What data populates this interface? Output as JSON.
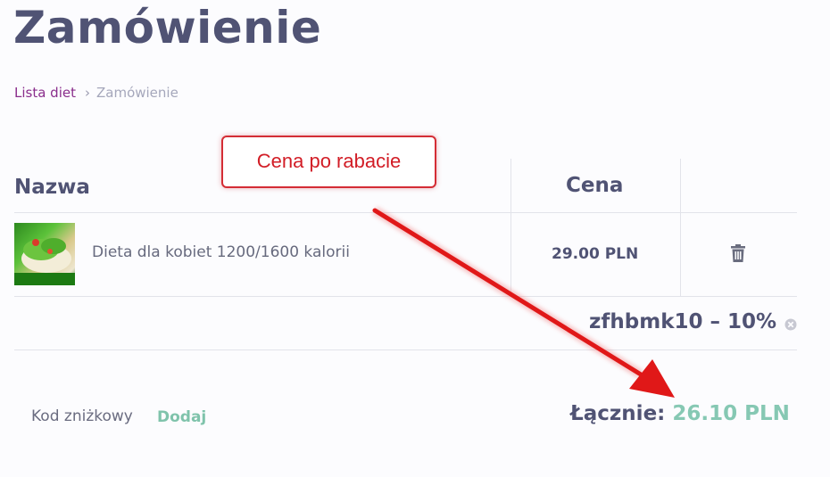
{
  "header": {
    "title": "Zamówienie"
  },
  "breadcrumb": {
    "link": "Lista diet",
    "current": "Zamówienie",
    "separator": "›"
  },
  "table": {
    "headers": {
      "name": "Nazwa",
      "price": "Cena"
    },
    "rows": [
      {
        "name": "Dieta dla kobiet 1200/1600 kalorii",
        "price": "29.00 PLN",
        "image_icon": "salad-photo",
        "delete_icon": "trash-icon"
      }
    ]
  },
  "discount": {
    "label": "zfhbmk10 – 10%",
    "remove_icon": "close-circle-icon"
  },
  "footer": {
    "code_label": "Kod zniżkowy",
    "add_label": "Dodaj",
    "total_label": "Łącznie:",
    "total_value": "26.10 PLN"
  },
  "annotation": {
    "text": "Cena po rabacie",
    "color": "#d21d26"
  },
  "colors": {
    "accent": "#86c8b3",
    "link": "#8a2e8c",
    "title": "#505374"
  }
}
